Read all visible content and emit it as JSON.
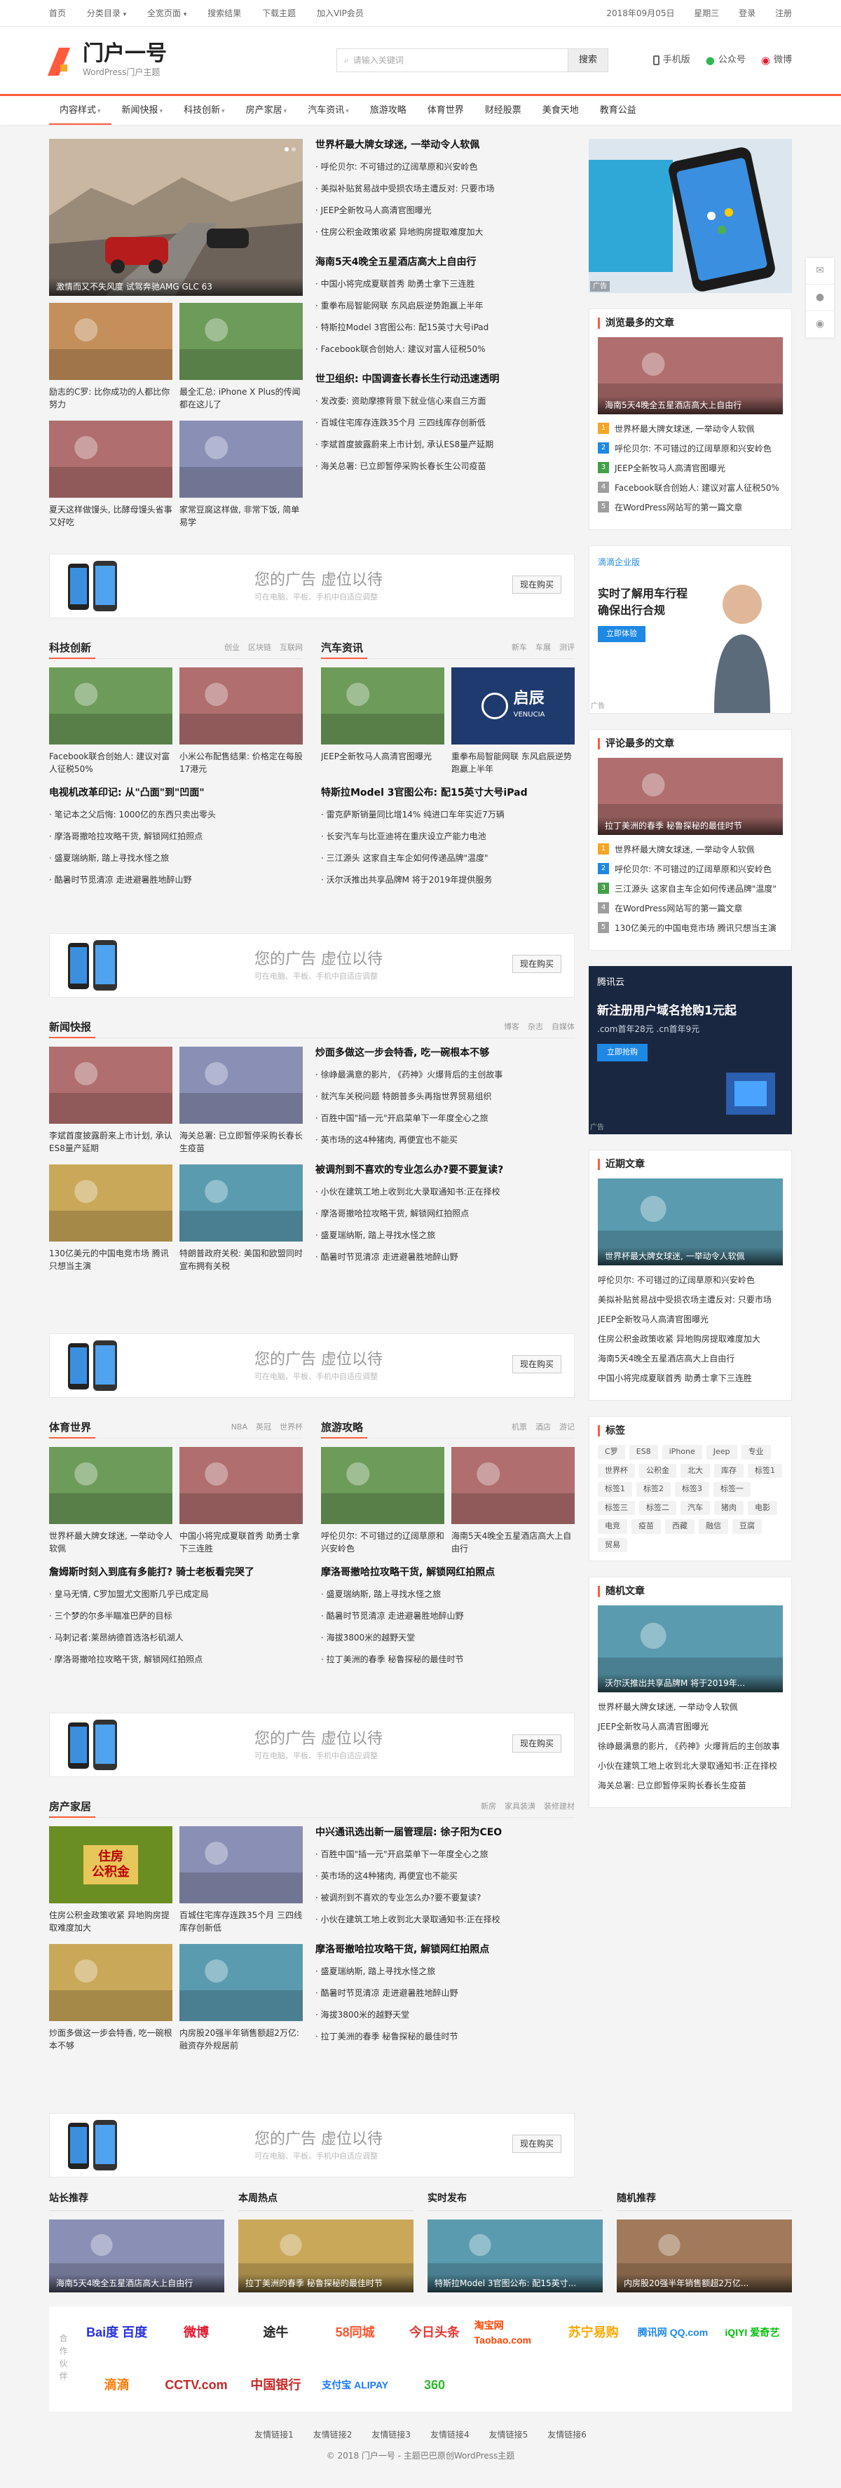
{
  "topbar": {
    "links": [
      "首页",
      "分类目录",
      "全宽页面",
      "搜索结果",
      "下载主题",
      "加入VIP会员"
    ],
    "dropdown_caret": "▾",
    "date": "2018年09月05日",
    "weekday": "星期三",
    "login": "登录",
    "register": "注册"
  },
  "header": {
    "site_name": "门户一号",
    "site_subtitle": "WordPress门户主题",
    "search_placeholder": "请输入关键词",
    "search_button": "搜索",
    "links": [
      {
        "label": "手机版",
        "icon": "mobile-icon"
      },
      {
        "label": "公众号",
        "icon": "wechat-icon"
      },
      {
        "label": "微博",
        "icon": "weibo-icon"
      }
    ]
  },
  "nav": {
    "items": [
      {
        "label": "内容样式",
        "dropdown": true
      },
      {
        "label": "新闻快报",
        "dropdown": true
      },
      {
        "label": "科技创新",
        "dropdown": true
      },
      {
        "label": "房产家居",
        "dropdown": true
      },
      {
        "label": "汽车资讯",
        "dropdown": true
      },
      {
        "label": "旅游攻略",
        "dropdown": false
      },
      {
        "label": "体育世界",
        "dropdown": false
      },
      {
        "label": "财经股票",
        "dropdown": false
      },
      {
        "label": "美食天地",
        "dropdown": false
      },
      {
        "label": "教育公益",
        "dropdown": false
      }
    ]
  },
  "featured": {
    "slide_caption": "激情而又不失风度 试驾奔驰AMG GLC 63",
    "small": [
      {
        "title": "励志的C罗: 比你成功的人都比你努力"
      },
      {
        "title": "最全汇总: iPhone X Plus的传闻都在这儿了"
      },
      {
        "title": "夏天这样做馒头, 比酵母馒头省事又好吃"
      },
      {
        "title": "家常豆腐这样做, 非常下饭, 简单易学"
      }
    ],
    "groups": [
      {
        "headline": "世界杯最大牌女球迷, 一举动令人软佩",
        "items": [
          "呼伦贝尔: 不可错过的辽阔草原和兴安岭色",
          "美拟补贴贫易战中受损农场主遭反对: 只要市场",
          "JEEP全新牧马人高清官图曝光",
          "住房公积金政策收紧 异地购房提取难度加大"
        ]
      },
      {
        "headline": "海南5天4晚全五星酒店高大上自由行",
        "items": [
          "中国小将完成夏联首秀 助勇士拿下三连胜",
          "重拳布局智能网联 东风启辰逆势跑赢上半年",
          "特斯拉Model 3官图公布: 配15英寸大号iPad",
          "Facebook联合创始人: 建议对富人征税50%"
        ]
      },
      {
        "headline": "世卫组织: 中国调查长春长生行动迅速透明",
        "items": [
          "发改委: 资助摩擦背景下就业信心来自三方面",
          "百城住宅库存连跌35个月 三四线库存创新低",
          "李斌首度披露蔚来上市计划, 承认ES8量产延期",
          "海关总署: 已立即暂停采购长春长生公司疫苗"
        ]
      }
    ]
  },
  "ad": {
    "title": "您的广告 虚位以待",
    "subtitle": "可在电脑、平板、手机中自适应调整",
    "button": "现在购买"
  },
  "tech": {
    "title": "科技创新",
    "tags": [
      "创业",
      "区块链",
      "互联网"
    ],
    "cards": [
      {
        "title": "Facebook联合创始人: 建议对富人征税50%"
      },
      {
        "title": "小米公布配售结果: 价格定在每股17港元"
      }
    ],
    "items": [
      "电视机改革印记: 从\"凸面\"到\"凹面\"",
      "笔记本之父后悔: 1000亿的东西只卖出零头",
      "摩洛哥撤哈拉攻略干货, 解锁网红拍照点",
      "盛夏瑞纳斯, 踏上寻找水怪之旅",
      "酷暑时节觅清凉 走进避暑胜地醉山野"
    ]
  },
  "car": {
    "title": "汽车资讯",
    "tags": [
      "新车",
      "车展",
      "测评"
    ],
    "cards": [
      {
        "title": "JEEP全新牧马人高清官图曝光"
      },
      {
        "title": "重拳布局智能网联 东风启辰逆势跑赢上半年"
      }
    ],
    "venucia": [
      "启辰",
      "VENUCIA"
    ],
    "items": [
      "特斯拉Model 3官图公布: 配15英寸大号iPad",
      "雷克萨斯销量同比增14% 纯进口车年实近7万辆",
      "长安汽车与比亚迪将在重庆设立产能力电池",
      "三江源头 这家自主车企如何传递品牌\"温度\"",
      "沃尔沃推出共享品牌M 将于2019年提供服务"
    ]
  },
  "news": {
    "title": "新闻快报",
    "tags": [
      "博客",
      "杂志",
      "自媒体"
    ],
    "cards": [
      {
        "title": "李斌首度披露蔚来上市计划, 承认ES8量产延期"
      },
      {
        "title": "海关总署: 已立即暂停采购长春长生疫苗"
      },
      {
        "title": "130亿美元的中国电竞市场 腾讯只想当主演"
      },
      {
        "title": "特朗普政府关税: 美国和欧盟同时宣布拥有关税"
      }
    ],
    "groups": [
      {
        "headline": "炒面多做这一步会特香, 吃一碗根本不够",
        "items": [
          "徐峥最满意的影片, 《药神》火爆背后的主创故事",
          "就汽车关税问题 特朗普多头再指世界贸易组织",
          "百胜中国\"插一元\"开启菜单下一年度全心之旅",
          "英市场的这4种猪肉, 再便宜也不能买"
        ]
      },
      {
        "headline": "被调剂到不喜欢的专业怎么办?要不要复读?",
        "items": [
          "小伙在建筑工地上收到北大录取通知书:正在择校",
          "摩洛哥撤哈拉攻略干货, 解锁网红拍照点",
          "盛夏瑞纳斯, 踏上寻找水怪之旅",
          "酷暑时节觅清凉 走进避暑胜地醉山野"
        ]
      }
    ]
  },
  "sports": {
    "title": "体育世界",
    "tags": [
      "NBA",
      "英冠",
      "世界杯"
    ],
    "cards": [
      {
        "title": "世界杯最大牌女球迷, 一举动令人软佩"
      },
      {
        "title": "中国小将完成夏联首秀 助勇士拿下三连胜"
      }
    ],
    "items": [
      "詹姆斯时刻入到底有多能打? 骑士老板看完哭了",
      "皇马无情, C罗加盟尤文图斯几乎已成定局",
      "三个梦的尔多半瞄准巴萨的目标",
      "马刺记者:莱昂纳德首选洛杉矶湖人",
      "摩洛哥撤哈拉攻略干货, 解锁网红拍照点"
    ]
  },
  "travel": {
    "title": "旅游攻略",
    "tags": [
      "机票",
      "酒店",
      "游记"
    ],
    "cards": [
      {
        "title": "呼伦贝尔: 不可错过的辽阔草原和兴安岭色"
      },
      {
        "title": "海南5天4晚全五星酒店高大上自由行"
      }
    ],
    "items": [
      "摩洛哥撤哈拉攻略干货, 解锁网红拍照点",
      "盛夏瑞纳斯, 踏上寻找水怪之旅",
      "酷暑时节觅清凉 走进避暑胜地醉山野",
      "海拔3800米的越野天堂",
      "拉丁美洲的春季 秘鲁探秘的最佳时节"
    ]
  },
  "house": {
    "title": "房产家居",
    "tags": [
      "新房",
      "家具装潢",
      "装修建材"
    ],
    "gjj": [
      "住房",
      "公积金"
    ],
    "cards": [
      {
        "title": "住房公积金政策收紧 异地购房提取难度加大"
      },
      {
        "title": "百城住宅库存连跌35个月 三四线库存创新低"
      },
      {
        "title": "炒面多做这一步会特香, 吃一碗根本不够"
      },
      {
        "title": "内房股20强半年销售额超2万亿:融资存外规居前"
      }
    ],
    "groups": [
      {
        "headline": "中兴通讯选出新一届管理层: 徐子阳为CEO",
        "items": [
          "百胜中国\"插一元\"开启菜单下一年度全心之旅",
          "英市场的这4种猪肉, 再便宜也不能买",
          "被调剂到不喜欢的专业怎么办?要不要复读?",
          "小伙在建筑工地上收到北大录取通知书:正在择校"
        ]
      },
      {
        "headline": "摩洛哥撤哈拉攻略干货, 解锁网红拍照点",
        "items": [
          "盛夏瑞纳斯, 踏上寻找水怪之旅",
          "酷暑时节觅清凉 走进避暑胜地醉山野",
          "海拔3800米的越野天堂",
          "拉丁美洲的春季 秘鲁探秘的最佳时节"
        ]
      }
    ]
  },
  "sidebar": {
    "ad_label": "广告",
    "browse": {
      "title": "浏览最多的文章",
      "feature": "海南5天4晚全五星酒店高大上自由行",
      "items": [
        "世界杯最大牌女球迷, 一举动令人软佩",
        "呼伦贝尔: 不可错过的辽阔草原和兴安岭色",
        "JEEP全新牧马人高清官图曝光",
        "Facebook联合创始人: 建议对富人征税50%",
        "在WordPress网站写的第一篇文章"
      ],
      "colors": [
        "#f6a623",
        "#1e88e5",
        "#43a047",
        "#9e9e9e",
        "#9e9e9e"
      ]
    },
    "car_ad": {
      "brand": "滴滴企业版",
      "line1": "实时了解用车行程",
      "line2": "确保出行合规",
      "btn": "立即体验"
    },
    "comment": {
      "title": "评论最多的文章",
      "feature": "拉丁美洲的春季 秘鲁探秘的最佳时节",
      "items": [
        "世界杯最大牌女球迷, 一举动令人软佩",
        "呼伦贝尔: 不可错过的辽阔草原和兴安岭色",
        "三江源头 这家自主车企如何传递品牌\"温度\"",
        "在WordPress网站写的第一篇文章",
        "130亿美元的中国电竞市场 腾讯只想当主演"
      ],
      "colors": [
        "#f6a623",
        "#1e88e5",
        "#43a047",
        "#9e9e9e",
        "#9e9e9e"
      ]
    },
    "cloud_ad": {
      "brand": "腾讯云",
      "line1": "新注册用户域名抢购1元起",
      "line2": ".com首年28元 .cn首年9元",
      "btn": "立即抢购"
    },
    "recent": {
      "title": "近期文章",
      "feature": "世界杯最大牌女球迷, 一举动令人软佩",
      "items": [
        "呼伦贝尔: 不可错过的辽阔草原和兴安岭色",
        "美拟补贴贫易战中受损农场主遭反对: 只要市场",
        "JEEP全新牧马人高清官图曝光",
        "住房公积金政策收紧 异地购房提取难度加大",
        "海南5天4晚全五星酒店高大上自由行",
        "中国小将完成夏联首秀 助勇士拿下三连胜"
      ]
    },
    "tags": {
      "title": "标签",
      "list": [
        "C罗",
        "ES8",
        "iPhone",
        "Jeep",
        "专业",
        "世界杯",
        "公积金",
        "北大",
        "库存",
        "标签1",
        "标签1",
        "标签2",
        "标签3",
        "标签一",
        "标签三",
        "标签二",
        "汽车",
        "猪肉",
        "电影",
        "电竞",
        "疫苗",
        "西藏",
        "融信",
        "豆腐",
        "贸易"
      ]
    },
    "random": {
      "title": "随机文章",
      "feature": "沃尔沃推出共享品牌M 将于2019年...",
      "items": [
        "世界杯最大牌女球迷, 一举动令人软佩",
        "JEEP全新牧马人高清官图曝光",
        "徐峥最满意的影片, 《药神》火爆背后的主创故事",
        "小伙在建筑工地上收到北大录取通知书:正在择校",
        "海关总署: 已立即暂停采购长春长生疫苗"
      ]
    }
  },
  "footer": {
    "cols": [
      {
        "title": "站长推荐",
        "caption": "海南5天4晚全五星酒店高大上自由行"
      },
      {
        "title": "本周热点",
        "caption": "拉丁美洲的春季 秘鲁探秘的最佳时节"
      },
      {
        "title": "实时发布",
        "caption": "特斯拉Model 3官图公布: 配15英寸..."
      },
      {
        "title": "随机推荐",
        "caption": "内房股20强半年销售额超2万亿..."
      }
    ],
    "partner_label": "合作伙伴",
    "partners": [
      {
        "name": "Bai度 百度",
        "color": "#2932e1"
      },
      {
        "name": "微博",
        "color": "#e6162d"
      },
      {
        "name": "途牛",
        "color": "#222"
      },
      {
        "name": "58同城",
        "color": "#ff552e"
      },
      {
        "name": "今日头条",
        "color": "#e53935"
      },
      {
        "name": "淘宝网 Taobao.com",
        "color": "#ff4400"
      },
      {
        "name": "苏宁易购",
        "color": "#f9a800"
      },
      {
        "name": "腾讯网 QQ.com",
        "color": "#1e88e5"
      },
      {
        "name": "iQIYI 爱奇艺",
        "color": "#00be06"
      },
      {
        "name": "滴滴",
        "color": "#ff7a00"
      },
      {
        "name": "CCTV.com",
        "color": "#c62828"
      },
      {
        "name": "中国银行",
        "color": "#c62828"
      },
      {
        "name": "支付宝 ALIPAY",
        "color": "#1677ff"
      },
      {
        "name": "360",
        "color": "#2eb82e"
      }
    ],
    "links": [
      "友情链接1",
      "友情链接2",
      "友情链接3",
      "友情链接4",
      "友情链接5",
      "友情链接6"
    ],
    "copyright": "© 2018 门户一号 - 主题巴巴原创WordPress主题"
  },
  "colors": {
    "accent": "#ff5a3c",
    "bg": "#f4f4f4"
  }
}
